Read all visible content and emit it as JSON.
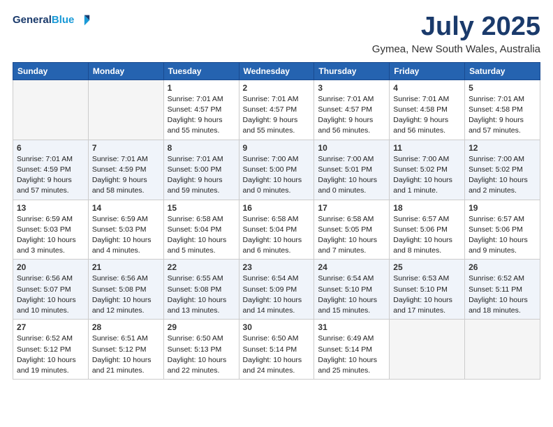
{
  "header": {
    "logo_line1": "General",
    "logo_line2": "Blue",
    "month": "July 2025",
    "location": "Gymea, New South Wales, Australia"
  },
  "weekdays": [
    "Sunday",
    "Monday",
    "Tuesday",
    "Wednesday",
    "Thursday",
    "Friday",
    "Saturday"
  ],
  "weeks": [
    [
      {
        "day": "",
        "info": ""
      },
      {
        "day": "",
        "info": ""
      },
      {
        "day": "1",
        "info": "Sunrise: 7:01 AM\nSunset: 4:57 PM\nDaylight: 9 hours\nand 55 minutes."
      },
      {
        "day": "2",
        "info": "Sunrise: 7:01 AM\nSunset: 4:57 PM\nDaylight: 9 hours\nand 55 minutes."
      },
      {
        "day": "3",
        "info": "Sunrise: 7:01 AM\nSunset: 4:57 PM\nDaylight: 9 hours\nand 56 minutes."
      },
      {
        "day": "4",
        "info": "Sunrise: 7:01 AM\nSunset: 4:58 PM\nDaylight: 9 hours\nand 56 minutes."
      },
      {
        "day": "5",
        "info": "Sunrise: 7:01 AM\nSunset: 4:58 PM\nDaylight: 9 hours\nand 57 minutes."
      }
    ],
    [
      {
        "day": "6",
        "info": "Sunrise: 7:01 AM\nSunset: 4:59 PM\nDaylight: 9 hours\nand 57 minutes."
      },
      {
        "day": "7",
        "info": "Sunrise: 7:01 AM\nSunset: 4:59 PM\nDaylight: 9 hours\nand 58 minutes."
      },
      {
        "day": "8",
        "info": "Sunrise: 7:01 AM\nSunset: 5:00 PM\nDaylight: 9 hours\nand 59 minutes."
      },
      {
        "day": "9",
        "info": "Sunrise: 7:00 AM\nSunset: 5:00 PM\nDaylight: 10 hours\nand 0 minutes."
      },
      {
        "day": "10",
        "info": "Sunrise: 7:00 AM\nSunset: 5:01 PM\nDaylight: 10 hours\nand 0 minutes."
      },
      {
        "day": "11",
        "info": "Sunrise: 7:00 AM\nSunset: 5:02 PM\nDaylight: 10 hours\nand 1 minute."
      },
      {
        "day": "12",
        "info": "Sunrise: 7:00 AM\nSunset: 5:02 PM\nDaylight: 10 hours\nand 2 minutes."
      }
    ],
    [
      {
        "day": "13",
        "info": "Sunrise: 6:59 AM\nSunset: 5:03 PM\nDaylight: 10 hours\nand 3 minutes."
      },
      {
        "day": "14",
        "info": "Sunrise: 6:59 AM\nSunset: 5:03 PM\nDaylight: 10 hours\nand 4 minutes."
      },
      {
        "day": "15",
        "info": "Sunrise: 6:58 AM\nSunset: 5:04 PM\nDaylight: 10 hours\nand 5 minutes."
      },
      {
        "day": "16",
        "info": "Sunrise: 6:58 AM\nSunset: 5:04 PM\nDaylight: 10 hours\nand 6 minutes."
      },
      {
        "day": "17",
        "info": "Sunrise: 6:58 AM\nSunset: 5:05 PM\nDaylight: 10 hours\nand 7 minutes."
      },
      {
        "day": "18",
        "info": "Sunrise: 6:57 AM\nSunset: 5:06 PM\nDaylight: 10 hours\nand 8 minutes."
      },
      {
        "day": "19",
        "info": "Sunrise: 6:57 AM\nSunset: 5:06 PM\nDaylight: 10 hours\nand 9 minutes."
      }
    ],
    [
      {
        "day": "20",
        "info": "Sunrise: 6:56 AM\nSunset: 5:07 PM\nDaylight: 10 hours\nand 10 minutes."
      },
      {
        "day": "21",
        "info": "Sunrise: 6:56 AM\nSunset: 5:08 PM\nDaylight: 10 hours\nand 12 minutes."
      },
      {
        "day": "22",
        "info": "Sunrise: 6:55 AM\nSunset: 5:08 PM\nDaylight: 10 hours\nand 13 minutes."
      },
      {
        "day": "23",
        "info": "Sunrise: 6:54 AM\nSunset: 5:09 PM\nDaylight: 10 hours\nand 14 minutes."
      },
      {
        "day": "24",
        "info": "Sunrise: 6:54 AM\nSunset: 5:10 PM\nDaylight: 10 hours\nand 15 minutes."
      },
      {
        "day": "25",
        "info": "Sunrise: 6:53 AM\nSunset: 5:10 PM\nDaylight: 10 hours\nand 17 minutes."
      },
      {
        "day": "26",
        "info": "Sunrise: 6:52 AM\nSunset: 5:11 PM\nDaylight: 10 hours\nand 18 minutes."
      }
    ],
    [
      {
        "day": "27",
        "info": "Sunrise: 6:52 AM\nSunset: 5:12 PM\nDaylight: 10 hours\nand 19 minutes."
      },
      {
        "day": "28",
        "info": "Sunrise: 6:51 AM\nSunset: 5:12 PM\nDaylight: 10 hours\nand 21 minutes."
      },
      {
        "day": "29",
        "info": "Sunrise: 6:50 AM\nSunset: 5:13 PM\nDaylight: 10 hours\nand 22 minutes."
      },
      {
        "day": "30",
        "info": "Sunrise: 6:50 AM\nSunset: 5:14 PM\nDaylight: 10 hours\nand 24 minutes."
      },
      {
        "day": "31",
        "info": "Sunrise: 6:49 AM\nSunset: 5:14 PM\nDaylight: 10 hours\nand 25 minutes."
      },
      {
        "day": "",
        "info": ""
      },
      {
        "day": "",
        "info": ""
      }
    ]
  ]
}
